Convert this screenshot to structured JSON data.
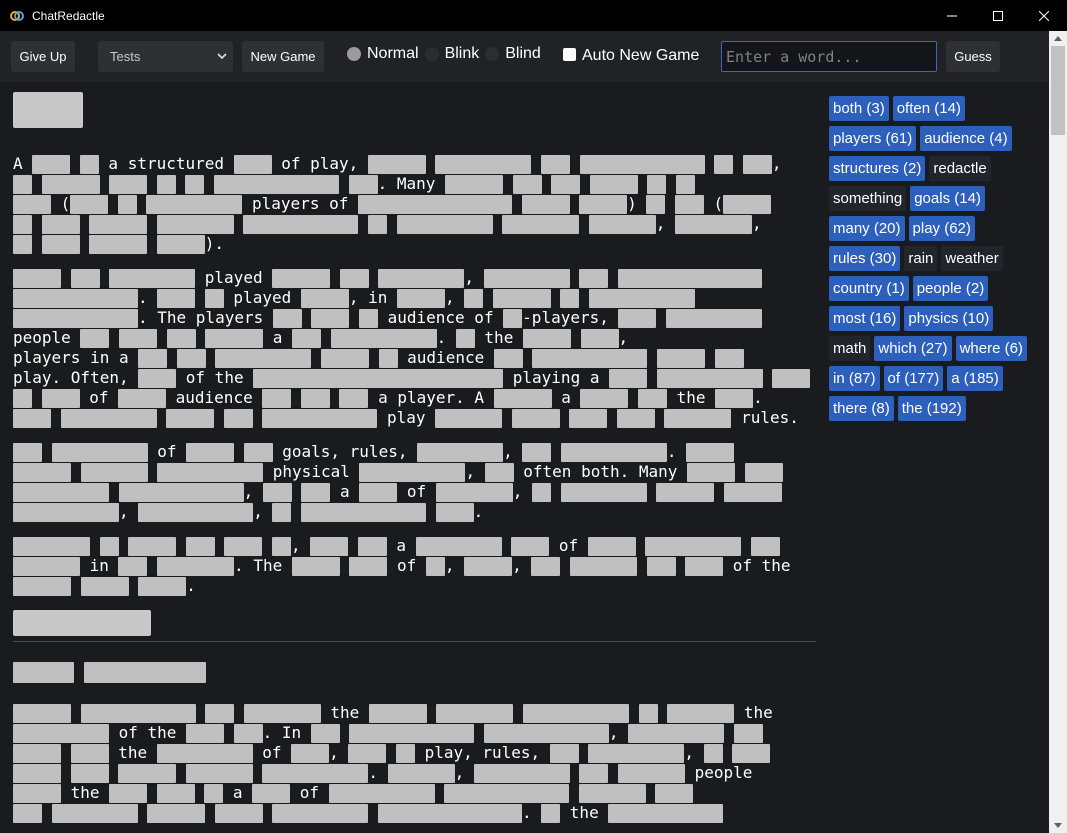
{
  "window": {
    "title": "ChatRedactle"
  },
  "toolbar": {
    "give_up": "Give Up",
    "select_value": "Tests",
    "new_game": "New Game",
    "modes": [
      "Normal",
      "Blink",
      "Blind"
    ],
    "auto_new_game": "Auto New Game",
    "input_placeholder": "Enter a word...",
    "guess": "Guess"
  },
  "article": {
    "p1": {
      "a": "A",
      "b": "a structured",
      "c": "of play,",
      "d": ". Many",
      "e": "(",
      "f": "players of",
      "g": ")",
      "h": "(",
      "i": ",",
      "j": ",",
      "k": ")."
    },
    "p2": {
      "a": "played",
      "b": ",",
      "c": ".",
      "d": "played",
      "e": ", in",
      "f": ",",
      "g": ". The players",
      "h": "audience of",
      "i": "-players,",
      "j": "people",
      "k": "a",
      "l": ".",
      "m": "the",
      "n": ",",
      "o": "players in a",
      "p": "audience",
      "q": "play. Often,",
      "r": "of the",
      "s": "playing a",
      "t": "of",
      "u": "audience",
      "v": "a player. A",
      "w": "a",
      "x": "the",
      "y": ".",
      "z": "play",
      "aa": "rules."
    },
    "p3": {
      "a": "of",
      "b": "goals, rules,",
      "c": ",",
      "d": ".",
      "e": "physical",
      "f": ",",
      "g": "often both. Many",
      "h": ",",
      "i": "a",
      "j": "of",
      "k": ",",
      "l": ",",
      "m": ",",
      "n": "."
    },
    "p4": {
      "a": ",",
      "b": "a",
      "c": "of",
      "d": "in",
      "e": ". The",
      "f": "of",
      "g": ",",
      "h": ",",
      "i": "of the",
      "j": "."
    },
    "p5": {
      "a": "the",
      "b": "the",
      "c": "of the",
      "d": ". In",
      "e": ",",
      "f": "the",
      "g": "of",
      "h": ",",
      "i": "play, rules,",
      "j": ",",
      "k": ".",
      "l": ",",
      "m": "people",
      "n": "the",
      "o": "a",
      "p": "of",
      "q": ".",
      "r": "the"
    }
  },
  "guesses": [
    {
      "label": "both (3)",
      "found": true
    },
    {
      "label": "often (14)",
      "found": true
    },
    {
      "label": "players (61)",
      "found": true
    },
    {
      "label": "audience (4)",
      "found": true
    },
    {
      "label": "structures (2)",
      "found": true
    },
    {
      "label": "redactle",
      "found": false
    },
    {
      "label": "something",
      "found": false
    },
    {
      "label": "goals (14)",
      "found": true
    },
    {
      "label": "many (20)",
      "found": true
    },
    {
      "label": "play (62)",
      "found": true
    },
    {
      "label": "rules (30)",
      "found": true
    },
    {
      "label": "rain",
      "found": false
    },
    {
      "label": "weather",
      "found": false
    },
    {
      "label": "country (1)",
      "found": true
    },
    {
      "label": "people (2)",
      "found": true
    },
    {
      "label": "most (16)",
      "found": true
    },
    {
      "label": "physics (10)",
      "found": true
    },
    {
      "label": "math",
      "found": false
    },
    {
      "label": "which (27)",
      "found": true
    },
    {
      "label": "where (6)",
      "found": true
    },
    {
      "label": "in (87)",
      "found": true
    },
    {
      "label": "of (177)",
      "found": true
    },
    {
      "label": "a (185)",
      "found": true
    },
    {
      "label": "there (8)",
      "found": true
    },
    {
      "label": "the (192)",
      "found": true
    }
  ]
}
